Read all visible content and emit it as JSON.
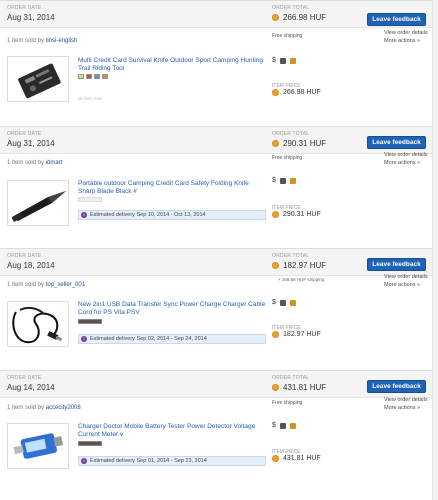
{
  "labels": {
    "order_date": "ORDER DATE",
    "order_total": "ORDER TOTAL",
    "item_price": "ITEM PRICE",
    "free_shipping": "Free shipping",
    "leave_feedback": "Leave feedback",
    "view_order_details": "View order details",
    "more_actions": "More actions »",
    "est_prefix": "Estimated delivery"
  },
  "orders": [
    {
      "date": "Aug 31, 2014",
      "total": "266.98 HUF",
      "seller_prefix": "1 item sold by",
      "seller": "tinsi-english",
      "shipping": "Free shipping",
      "title": "Multi Credit Card Survival Knife Outdoor Sport Camping Hunting Trail Riding Tool",
      "muted_note": "do item note",
      "item_price": "266.98 HUF"
    },
    {
      "date": "Aug 31, 2014",
      "total": "290.31 HUF",
      "seller_prefix": "1 item sold by",
      "seller": "idmart",
      "shipping": "Free shipping",
      "title": "Portable outdoor Camping Credit Card Safety Folding Knife Sharp Blade Black #",
      "estimate": "Estimated delivery Sep 10, 2014 - Oct 13, 2014",
      "item_price": "290.31 HUF"
    },
    {
      "date": "Aug 18, 2014",
      "total": "182.97 HUF",
      "seller_prefix": "1 item sold by",
      "seller": "top_seller_001",
      "shipping": "+ 166.58 HUF shipping",
      "title": "New 2in1 USB Data Transfer Sync Power Charge Charger Cable Cord for PS Vita PSV",
      "estimate": "Estimated delivery Sep 02, 2014 - Sep 24, 2014",
      "item_price": "182.97 HUF"
    },
    {
      "date": "Aug 14, 2014",
      "total": "431.81 HUF",
      "seller_prefix": "1 item sold by",
      "seller": "accecity2008",
      "shipping": "Free shipping",
      "title": "Charger Doctor Mobile Battery Tester Power Detector Voltage Current Meter v",
      "estimate": "Estimated delivery Sep 01, 2014 - Sep 23, 2014",
      "item_price": "431.81 HUF"
    }
  ]
}
